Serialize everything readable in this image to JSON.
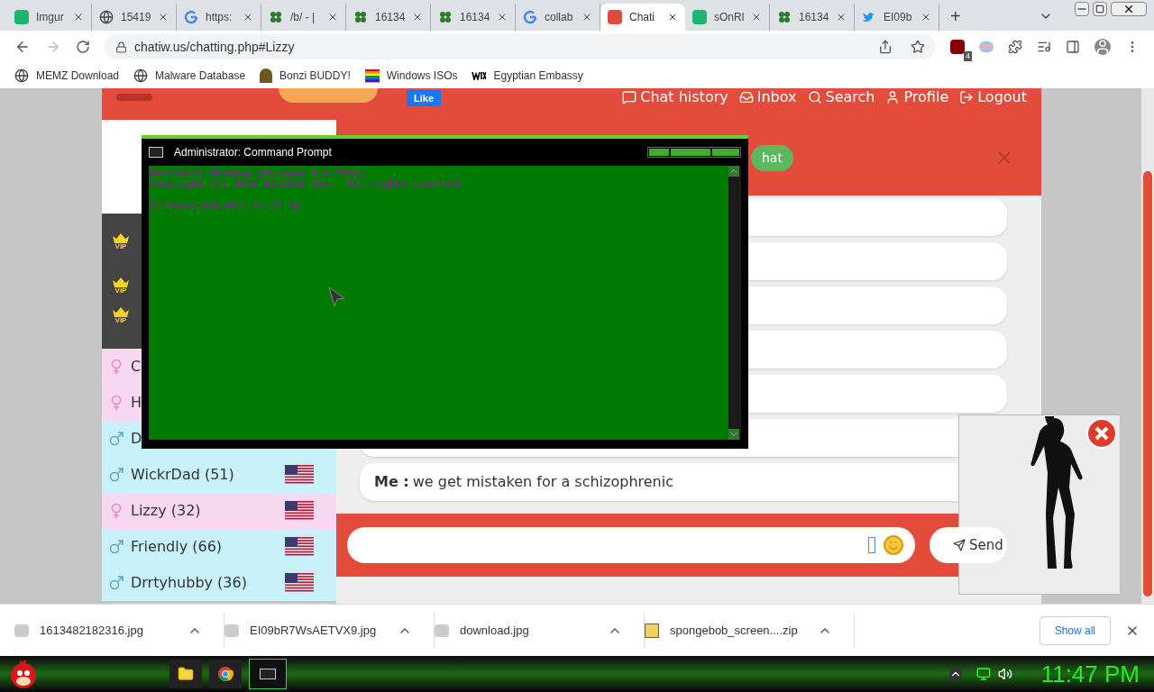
{
  "browser": {
    "tabs": [
      {
        "kind": "imgur",
        "label": "Imgur",
        "selected": false
      },
      {
        "kind": "globe",
        "label": "15419",
        "selected": false
      },
      {
        "kind": "google",
        "label": "https:",
        "selected": false
      },
      {
        "kind": "clover",
        "label": "/b/ - |",
        "selected": false
      },
      {
        "kind": "clover",
        "label": "16134",
        "selected": false
      },
      {
        "kind": "clover",
        "label": "16134",
        "selected": false
      },
      {
        "kind": "google",
        "label": "collab",
        "selected": false
      },
      {
        "kind": "chat",
        "label": "Chati",
        "selected": true
      },
      {
        "kind": "imgur",
        "label": "sOnRl",
        "selected": false
      },
      {
        "kind": "clover",
        "label": "16134",
        "selected": false
      },
      {
        "kind": "twitter",
        "label": "EI09b",
        "selected": false
      }
    ],
    "new_tab": "+",
    "address": "chatiw.us/chatting.php#Lizzy",
    "extension_badge": "4",
    "bookmarks": [
      {
        "kind": "globe",
        "label": "MEMZ Download"
      },
      {
        "kind": "globe",
        "label": "Malware Database"
      },
      {
        "kind": "bonzi",
        "label": "Bonzi BUDDY!"
      },
      {
        "kind": "rainbow",
        "label": "Windows ISOs"
      },
      {
        "kind": "wix",
        "label": "Egyptian Embassy"
      }
    ]
  },
  "site": {
    "like": "Like",
    "nav": [
      {
        "kind": "chat",
        "label": "Chat history"
      },
      {
        "kind": "inbox",
        "label": "Inbox"
      },
      {
        "kind": "search",
        "label": "Search"
      },
      {
        "kind": "profile",
        "label": "Profile"
      },
      {
        "kind": "logout",
        "label": "Logout"
      }
    ],
    "chat_button": "hat",
    "vip_badges": [
      "VIP",
      "VIP",
      "VIP"
    ],
    "users": [
      {
        "name": "C",
        "kind": "female",
        "flag": false
      },
      {
        "name": "H",
        "kind": "female",
        "flag": false
      },
      {
        "name": "D",
        "kind": "male",
        "flag": false
      },
      {
        "name": "WickrDad (51)",
        "kind": "male",
        "flag": true
      },
      {
        "name": "Lizzy (32)",
        "kind": "female",
        "flag": true
      },
      {
        "name": "Friendly (66)",
        "kind": "male",
        "flag": true
      },
      {
        "name": "Drrtyhubby (36)",
        "kind": "male",
        "flag": true
      }
    ],
    "messages": [
      {
        "sender": "Me :",
        "text": "we get mistaken for a schizophrenic"
      }
    ],
    "send": "Send"
  },
  "console": {
    "title": "Administrator: Command Prompt",
    "lines": [
      "Microsoft Windows [Version 6.1.7601]",
      "Copyright (c) 2012 Bilzbad Sys.  All rights reserved."
    ],
    "prompt": "C:\\Users\\LOL>del ?s ?f ?q"
  },
  "downloads": {
    "items": [
      {
        "kind": "image",
        "name": "1613482182316.jpg"
      },
      {
        "kind": "image",
        "name": "EI09bR7WsAETVX9.jpg"
      },
      {
        "kind": "image",
        "name": "download.jpg"
      },
      {
        "kind": "zip",
        "name": "spongebob_screen....zip"
      }
    ],
    "show_all": "Show all"
  },
  "taskbar": {
    "clock": "11:47 PM"
  }
}
